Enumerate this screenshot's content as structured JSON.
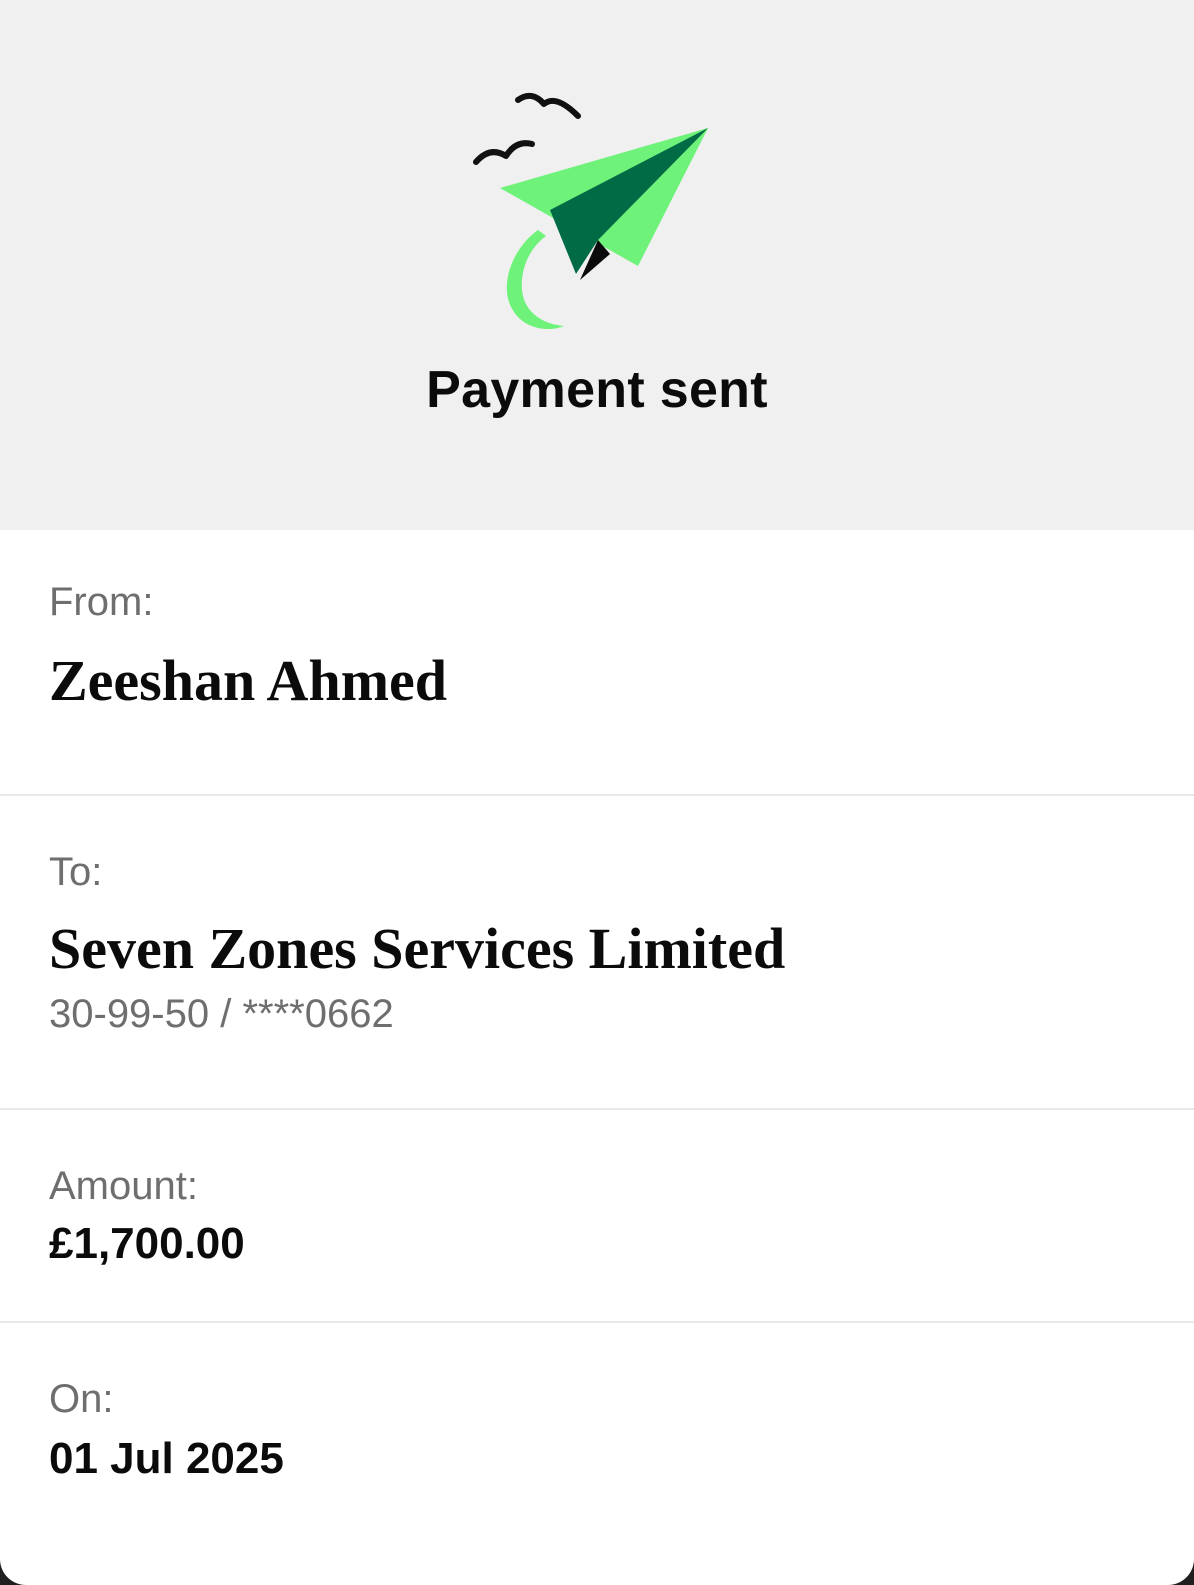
{
  "header": {
    "title": "Payment sent",
    "illustration_icon": "paper-plane-with-birds-icon"
  },
  "from": {
    "label": "From:",
    "name": "Zeeshan Ahmed"
  },
  "to": {
    "label": "To:",
    "name": "Seven Zones Services Limited",
    "account": "30-99-50 / ****0662"
  },
  "amount": {
    "label": "Amount:",
    "value": "£1,700.00"
  },
  "on": {
    "label": "On:",
    "date": "01 Jul 2025"
  },
  "colors": {
    "plane_light": "#6ef27a",
    "plane_dark": "#006b45",
    "header_bg": "#f0f0f0",
    "label_gray": "#6e6e6e"
  }
}
